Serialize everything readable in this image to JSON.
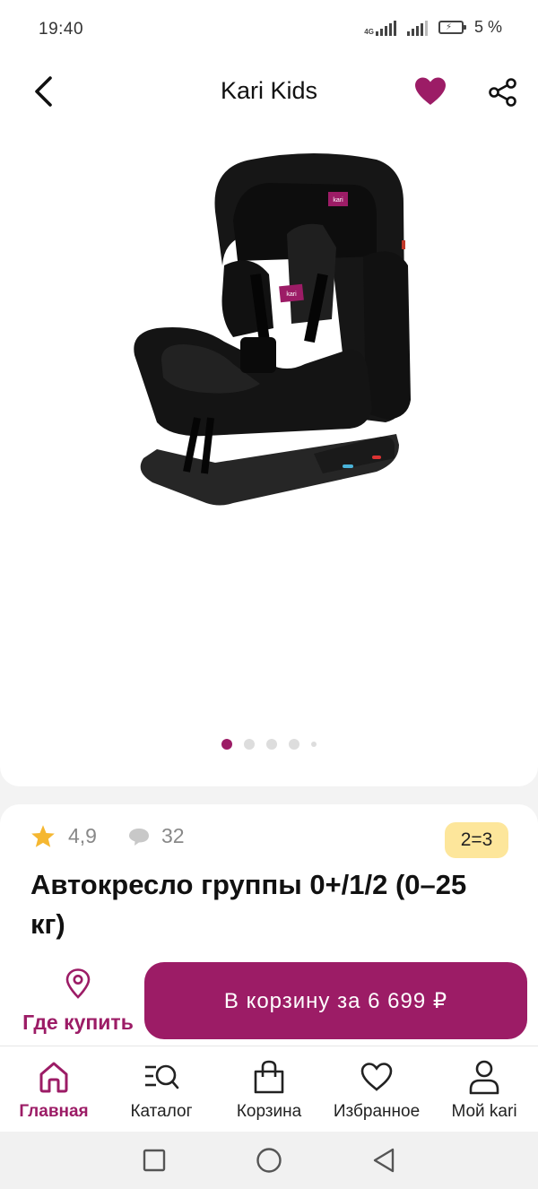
{
  "status_bar": {
    "time": "19:40",
    "network": "4G",
    "battery": "5 %"
  },
  "header": {
    "title": "Kari Kids"
  },
  "gallery": {
    "pages": 5,
    "active_index": 0
  },
  "product": {
    "rating": "4,9",
    "reviews": "32",
    "promo_badge": "2=3",
    "title": "Автокресло группы 0+/1/2 (0–25 кг)"
  },
  "actions": {
    "where_to_buy": "Где купить",
    "add_to_cart": "В корзину за 6 699 ₽"
  },
  "bottom_nav": [
    {
      "label": "Главная",
      "icon": "home-icon",
      "active": true
    },
    {
      "label": "Каталог",
      "icon": "catalog-search-icon",
      "active": false
    },
    {
      "label": "Корзина",
      "icon": "bag-icon",
      "active": false
    },
    {
      "label": "Избранное",
      "icon": "heart-outline-icon",
      "active": false
    },
    {
      "label": "Мой kari",
      "icon": "profile-icon",
      "active": false
    }
  ],
  "colors": {
    "brand": "#9c1c66",
    "badge": "#fde69b",
    "star": "#f5b731"
  }
}
